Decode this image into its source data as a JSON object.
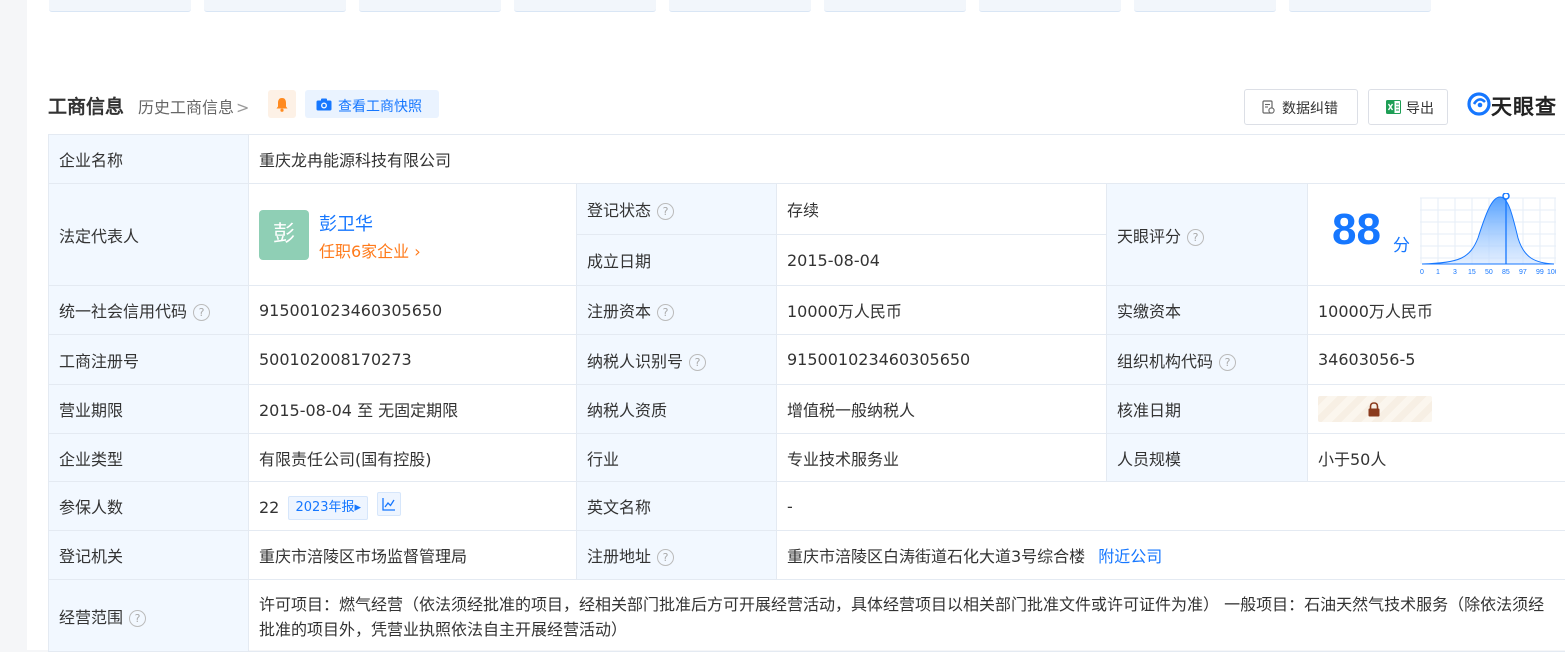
{
  "section": {
    "title": "工商信息",
    "history_link": "历史工商信息",
    "snapshot_button": "查看工商快照",
    "correct_button": "数据纠错",
    "export_button": "导出",
    "logo_text": "天眼查"
  },
  "company": {
    "name_label": "企业名称",
    "name_value": "重庆龙冉能源科技有限公司",
    "legal_rep_label": "法定代表人",
    "legal_rep_avatar": "彭",
    "legal_rep_name": "彭卫华",
    "legal_rep_jobs": "任职6家企业",
    "reg_status_label": "登记状态",
    "reg_status_value": "存续",
    "found_date_label": "成立日期",
    "found_date_value": "2015-08-04",
    "score_label": "天眼评分",
    "score_value": "88",
    "score_unit": "分",
    "score_axis": [
      "0",
      "1",
      "3",
      "15",
      "50",
      "85",
      "97",
      "99",
      "100"
    ],
    "credit_code_label": "统一社会信用代码",
    "credit_code_value": "915001023460305650",
    "reg_capital_label": "注册资本",
    "reg_capital_value": "10000万人民币",
    "paid_capital_label": "实缴资本",
    "paid_capital_value": "10000万人民币",
    "biz_reg_no_label": "工商注册号",
    "biz_reg_no_value": "500102008170273",
    "taxpayer_id_label": "纳税人识别号",
    "taxpayer_id_value": "915001023460305650",
    "org_code_label": "组织机构代码",
    "org_code_value": "34603056-5",
    "biz_term_label": "营业期限",
    "biz_term_value": "2015-08-04 至 无固定期限",
    "taxpayer_qual_label": "纳税人资质",
    "taxpayer_qual_value": "增值税一般纳税人",
    "approval_date_label": "核准日期",
    "type_label": "企业类型",
    "type_value": "有限责任公司(国有控股)",
    "industry_label": "行业",
    "industry_value": "专业技术服务业",
    "staff_size_label": "人员规模",
    "staff_size_value": "小于50人",
    "insured_label": "参保人数",
    "insured_value": "22",
    "insured_year": "2023年报",
    "english_name_label": "英文名称",
    "english_name_value": "-",
    "reg_authority_label": "登记机关",
    "reg_authority_value": "重庆市涪陵区市场监督管理局",
    "reg_address_label": "注册地址",
    "reg_address_value": "重庆市涪陵区白涛街道石化大道3号综合楼",
    "nearby_link": "附近公司",
    "scope_label": "经营范围",
    "scope_value": "许可项目：燃气经营（依法须经批准的项目，经相关部门批准后方可开展经营活动，具体经营项目以相关部门批准文件或许可证件为准） 一般项目：石油天然气技术服务（除依法须经批准的项目外，凭营业执照依法自主开展经营活动）"
  },
  "colors": {
    "accent": "#1677ff",
    "status_green": "#00964b",
    "jobs_orange": "#ff7a1a",
    "label_bg": "#f2f8ff"
  }
}
